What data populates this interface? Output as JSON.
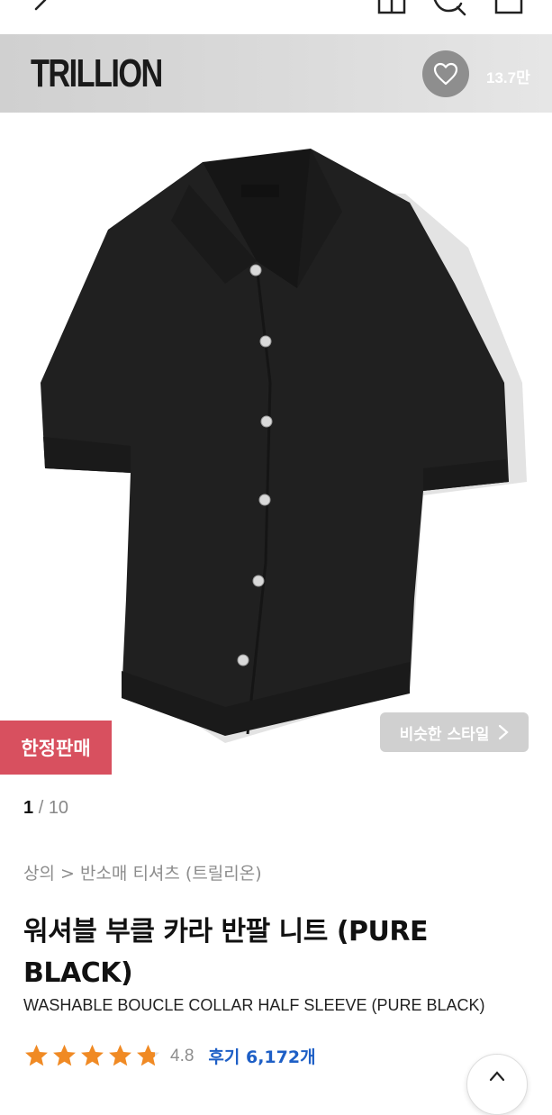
{
  "header": {
    "icons": [
      "back-icon",
      "home-icon",
      "search-icon",
      "shopping-bag-icon"
    ]
  },
  "brand": {
    "logo_text": "TRILLION",
    "like_icon": "heart-icon",
    "like_count": "13.7만"
  },
  "product": {
    "badge": "한정판매",
    "similar_style_label": "비슷한 스타일",
    "image_index": {
      "current": "1",
      "separator": "/",
      "total": "10"
    },
    "breadcrumb": "상의 > 반소매 티셔츠 (트릴리온)",
    "title_ko": "워셔블 부클 카라 반팔 니트 (PURE BLACK)",
    "title_en": "WASHABLE BOUCLE COLLAR HALF SLEEVE (PURE BLACK)",
    "rating": {
      "stars": 4.8,
      "value": "4.8",
      "review_label": "후기 6,172개"
    }
  },
  "colors": {
    "accent_red": "#d8505f",
    "star": "#f08a24",
    "link_blue": "#1e5fc6"
  }
}
